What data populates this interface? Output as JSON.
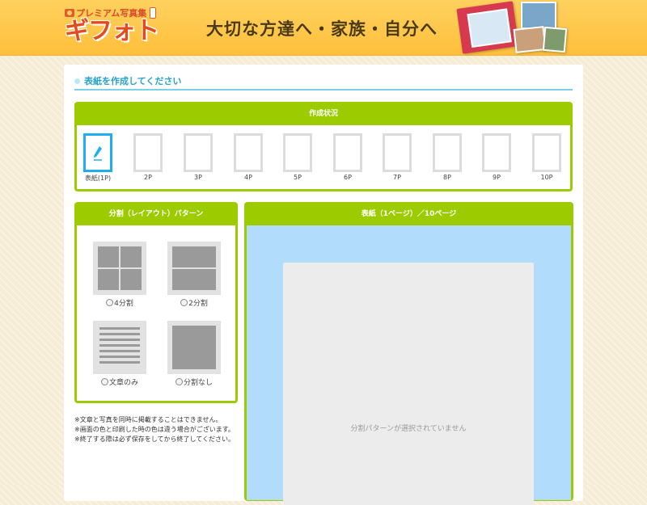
{
  "header": {
    "logo_small": "プレミアム写真集",
    "logo_main": "ギフォト",
    "tagline": "大切な方達へ・家族・自分へ"
  },
  "section_title": "表紙を作成してください",
  "status": {
    "title": "作成状況",
    "pages": [
      "表紙(1P)",
      "2P",
      "3P",
      "4P",
      "5P",
      "6P",
      "7P",
      "8P",
      "9P",
      "10P"
    ]
  },
  "layout": {
    "title": "分割（レイアウト）パターン",
    "options": [
      "4分割",
      "2分割",
      "文章のみ",
      "分割なし"
    ]
  },
  "notes": [
    "※文章と写真を同時に掲載することはできません。",
    "※画面の色と印刷した時の色は違う場合がございます。",
    "※終了する際は必ず保存をしてから終了してください。"
  ],
  "cover": {
    "title": "表紙（1ページ）／10ページ",
    "empty_message": "分割パターンが選択されていません"
  },
  "colors": {
    "accent_green": "#9ccc00",
    "accent_blue": "#27a3c8",
    "header_orange": "#ffc64a",
    "cover_bg": "#b2dcfc"
  }
}
